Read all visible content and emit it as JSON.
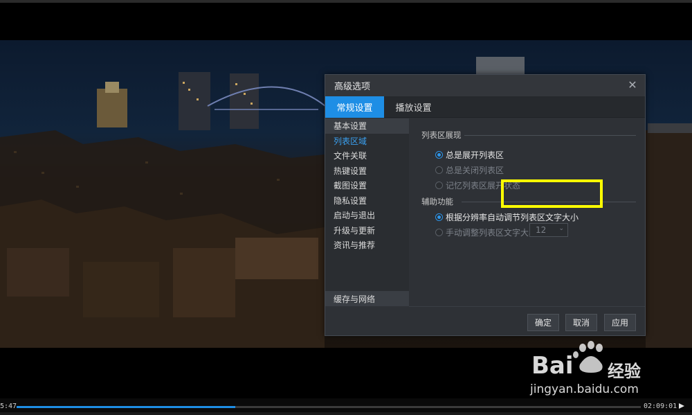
{
  "dialog": {
    "title": "高级选项",
    "close_icon": "close-icon",
    "tabs": [
      {
        "label": "常规设置",
        "active": true
      },
      {
        "label": "播放设置",
        "active": false
      }
    ],
    "sidebar": {
      "items": [
        {
          "label": "基本设置"
        },
        {
          "label": "列表区域"
        },
        {
          "label": "文件关联"
        },
        {
          "label": "热键设置"
        },
        {
          "label": "截图设置"
        },
        {
          "label": "隐私设置"
        },
        {
          "label": "启动与退出"
        },
        {
          "label": "升级与更新"
        },
        {
          "label": "资讯与推荐"
        }
      ],
      "selected": "列表区域",
      "bottom_item": "缓存与网络"
    },
    "content": {
      "section1_title": "列表区展现",
      "section1_options": [
        {
          "label": "总是展开列表区",
          "checked": true,
          "enabled": true
        },
        {
          "label": "总是关闭列表区",
          "checked": false,
          "enabled": false
        },
        {
          "label": "记忆列表区展开状态",
          "checked": false,
          "enabled": false
        }
      ],
      "section2_title": "辅助功能",
      "section2_options": [
        {
          "label": "根据分辨率自动调节列表区文字大小",
          "checked": true,
          "enabled": true
        },
        {
          "label": "手动调整列表区文字大小",
          "checked": false,
          "enabled": false
        }
      ],
      "font_size_value": "12"
    },
    "buttons": {
      "ok": "确定",
      "cancel": "取消",
      "apply": "应用"
    }
  },
  "player": {
    "elapsed": "5:47",
    "total": "02:09:01",
    "progress_fraction": 0.35
  },
  "watermark": {
    "brand_left": "Bai",
    "brand_right": "经验",
    "url": "jingyan.baidu.com"
  },
  "colors": {
    "accent": "#1e8ee5",
    "highlight_box": "#ffff00",
    "dialog_bg": "#2e3136"
  }
}
